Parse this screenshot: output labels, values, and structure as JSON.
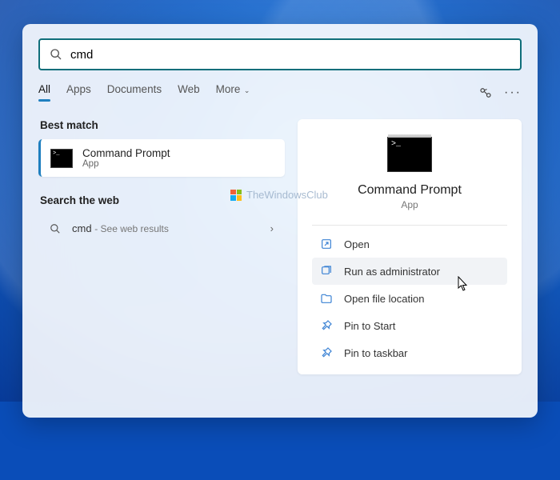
{
  "search": {
    "query": "cmd"
  },
  "tabs": {
    "all": "All",
    "apps": "Apps",
    "documents": "Documents",
    "web": "Web",
    "more": "More"
  },
  "sections": {
    "best_match": "Best match",
    "search_web": "Search the web"
  },
  "best_match": {
    "title": "Command Prompt",
    "subtitle": "App"
  },
  "web_result": {
    "query": "cmd",
    "hint": "- See web results"
  },
  "detail": {
    "title": "Command Prompt",
    "subtitle": "App"
  },
  "actions": {
    "open": "Open",
    "run_admin": "Run as administrator",
    "open_location": "Open file location",
    "pin_start": "Pin to Start",
    "pin_taskbar": "Pin to taskbar"
  },
  "watermark": "TheWindowsClub"
}
